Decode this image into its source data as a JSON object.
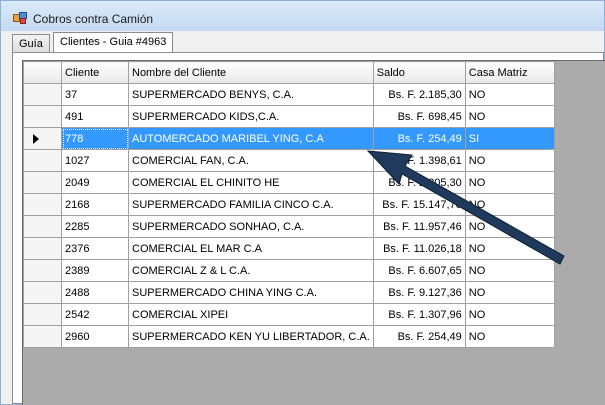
{
  "window": {
    "title": "Cobros contra Camión",
    "icon": "app-icon"
  },
  "tabs": [
    {
      "label": "Guía",
      "active": false
    },
    {
      "label": "Clientes - Guia #4963",
      "active": true
    }
  ],
  "grid": {
    "columns": [
      "Cliente",
      "Nombre del Cliente",
      "Saldo",
      "Casa Matriz"
    ],
    "selected_index": 2,
    "rows": [
      {
        "cliente": "37",
        "nombre": "SUPERMERCADO BENYS, C.A.",
        "saldo": "Bs. F. 2.185,30",
        "casa": "NO"
      },
      {
        "cliente": "491",
        "nombre": "SUPERMERCADO KIDS,C.A.",
        "saldo": "Bs. F. 698,45",
        "casa": "NO"
      },
      {
        "cliente": "778",
        "nombre": "AUTOMERCADO MARIBEL YING, C.A",
        "saldo": "Bs. F. 254,49",
        "casa": "SI"
      },
      {
        "cliente": "1027",
        "nombre": "COMERCIAL FAN, C.A.",
        "saldo": "Bs. F. 1.398,61",
        "casa": "NO"
      },
      {
        "cliente": "2049",
        "nombre": "COMERCIAL EL CHINITO HE",
        "saldo": "Bs. F. 2.205,30",
        "casa": "NO"
      },
      {
        "cliente": "2168",
        "nombre": "SUPERMERCADO FAMILIA CINCO C.A.",
        "saldo": "Bs. F. 15.147,70",
        "casa": "NO"
      },
      {
        "cliente": "2285",
        "nombre": "SUPERMERCADO SONHAO, C.A.",
        "saldo": "Bs. F. 11.957,46",
        "casa": "NO"
      },
      {
        "cliente": "2376",
        "nombre": "COMERCIAL EL MAR C.A",
        "saldo": "Bs. F. 11.026,18",
        "casa": "NO"
      },
      {
        "cliente": "2389",
        "nombre": "COMERCIAL Z & L C.A.",
        "saldo": "Bs. F. 6.607,65",
        "casa": "NO"
      },
      {
        "cliente": "2488",
        "nombre": "SUPERMERCADO CHINA YING C.A.",
        "saldo": "Bs. F. 9.127,36",
        "casa": "NO"
      },
      {
        "cliente": "2542",
        "nombre": "COMERCIAL XIPEI",
        "saldo": "Bs. F. 1.307,96",
        "casa": "NO"
      },
      {
        "cliente": "2960",
        "nombre": "SUPERMERCADO KEN YU LIBERTADOR, C.A.",
        "saldo": "Bs. F. 254,49",
        "casa": "NO"
      }
    ]
  },
  "colors": {
    "selection": "#3399ff",
    "arrow": "#1f3a5c"
  }
}
